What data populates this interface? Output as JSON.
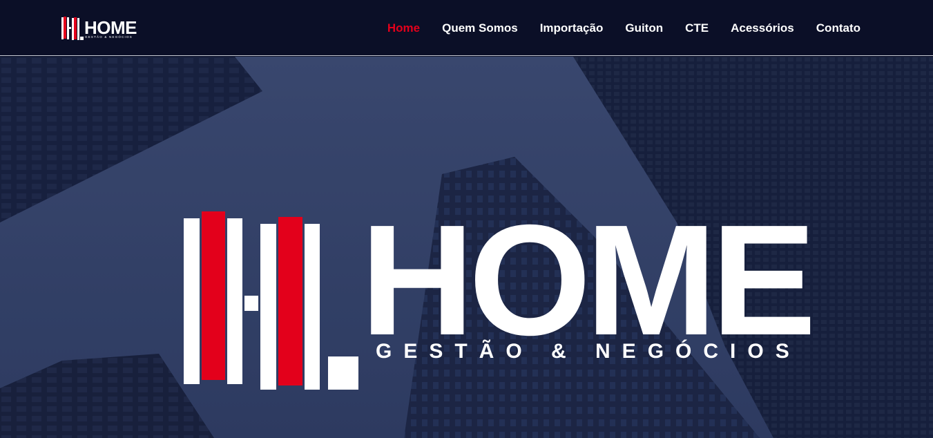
{
  "brand": {
    "name": "HOME",
    "tagline": "GESTÃO & NEGÓCIOS",
    "colors": {
      "accent": "#e3001b",
      "navy": "#0b0f27",
      "white": "#ffffff"
    }
  },
  "nav": {
    "items": [
      {
        "label": "Home",
        "active": true
      },
      {
        "label": "Quem Somos",
        "active": false
      },
      {
        "label": "Importação",
        "active": false
      },
      {
        "label": "Guiton",
        "active": false
      },
      {
        "label": "CTE",
        "active": false
      },
      {
        "label": "Acessórios",
        "active": false
      },
      {
        "label": "Contato",
        "active": false
      }
    ]
  },
  "hero": {
    "logo_word": "HOME",
    "logo_tagline": "GESTÃO & NEGÓCIOS",
    "background": "skyscrapers-photo"
  }
}
